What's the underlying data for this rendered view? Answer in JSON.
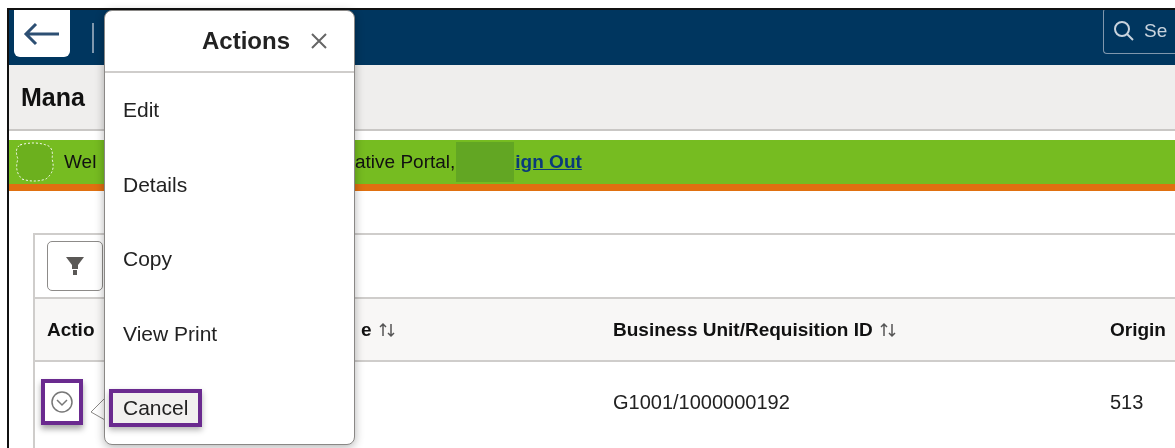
{
  "header": {
    "search": {
      "placeholder": "Se"
    }
  },
  "page_title": "Mana",
  "banner": {
    "greeting_start": "Wel",
    "greeting_end": "ative Portal,",
    "link": "ign Out"
  },
  "table": {
    "columns": [
      {
        "label": "Actio",
        "sortable": false
      },
      {
        "label": "e",
        "sortable": true
      },
      {
        "label": "Business Unit/Requisition ID",
        "sortable": true
      },
      {
        "label": "Origin",
        "sortable": false
      }
    ],
    "rows": [
      {
        "action_highlighted": true,
        "column_3": "G1001/1000000192",
        "column_4": "513"
      }
    ]
  },
  "popup": {
    "title": "Actions",
    "items": [
      {
        "label": "Edit",
        "highlighted": false
      },
      {
        "label": "Details",
        "highlighted": false
      },
      {
        "label": "Copy",
        "highlighted": false
      },
      {
        "label": "View Print",
        "highlighted": false
      },
      {
        "label": "Cancel",
        "highlighted": true
      }
    ]
  }
}
